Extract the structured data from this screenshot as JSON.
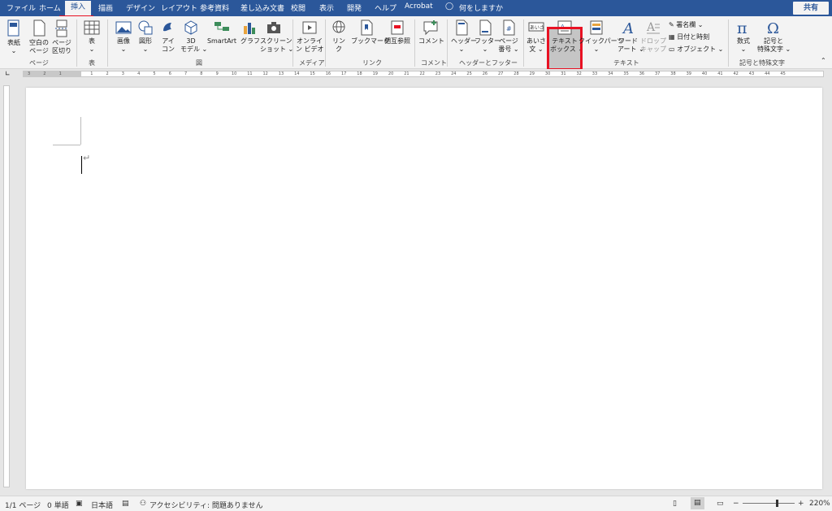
{
  "tabs": [
    {
      "label": "ファイル"
    },
    {
      "label": "ホーム"
    },
    {
      "label": "挿入"
    },
    {
      "label": "描画"
    },
    {
      "label": "デザイン"
    },
    {
      "label": "レイアウト"
    },
    {
      "label": "参考資料"
    },
    {
      "label": "差し込み文書"
    },
    {
      "label": "校閲"
    },
    {
      "label": "表示"
    },
    {
      "label": "開発"
    },
    {
      "label": "ヘルプ"
    },
    {
      "label": "Acrobat"
    }
  ],
  "active_tab": "挿入",
  "tell_me": "何をしますか",
  "share": "共有",
  "ribbon": {
    "pages": {
      "cover": "表紙",
      "blank1": "空白の",
      "blank2": "ページ",
      "break1": "ページ",
      "break2": "区切り",
      "group": "ページ"
    },
    "table": {
      "table": "表",
      "group": "表"
    },
    "illustrations": {
      "pictures": "画像",
      "shapes": "図形",
      "icons1": "アイ",
      "icons2": "コン",
      "model1": "3D",
      "model2": "モデル",
      "smartart": "SmartArt",
      "chart": "グラフ",
      "screenshot1": "スクリーン",
      "screenshot2": "ショット",
      "group": "図"
    },
    "media": {
      "video1": "オンライ",
      "video2": "ン ビデオ",
      "group": "メディア"
    },
    "links": {
      "link1": "リン",
      "link2": "ク",
      "bookmark": "ブックマーク",
      "crossref": "相互参照",
      "group": "リンク"
    },
    "comments": {
      "comment": "コメント",
      "group": "コメント"
    },
    "headerfooter": {
      "header": "ヘッダー",
      "footer": "フッター",
      "pagenum1": "ページ",
      "pagenum2": "番号",
      "group": "ヘッダーとフッター"
    },
    "text": {
      "greeting1": "あいさ",
      "greeting2": "文",
      "textbox1": "テキスト",
      "textbox2": "ボックス",
      "quickparts1": "クイック",
      "quickparts2": "パーツ",
      "wordart1": "ワード",
      "wordart2": "アート",
      "dropcap1": "ドロップ",
      "dropcap2": "キャップ",
      "signature": "署名欄",
      "datetime": "日付と時刻",
      "object": "オブジェクト",
      "group": "テキスト"
    },
    "symbols": {
      "equation": "数式",
      "symbol1": "記号と",
      "symbol2": "特殊文字",
      "group": "記号と特殊文字"
    }
  },
  "ruler_numbers": [
    "3",
    "2",
    "1",
    "",
    "1",
    "2",
    "3",
    "4",
    "5",
    "6",
    "7",
    "8",
    "9",
    "10",
    "11",
    "12",
    "13",
    "14",
    "15",
    "16",
    "17",
    "18",
    "19",
    "20",
    "21",
    "22",
    "23",
    "24",
    "25",
    "26",
    "27",
    "28",
    "29",
    "30",
    "31",
    "32",
    "33",
    "34",
    "35",
    "36",
    "37",
    "38",
    "39",
    "40",
    "41",
    "42",
    "43",
    "44",
    "45"
  ],
  "status": {
    "page": "1/1 ページ",
    "words": "0 単語",
    "language": "日本語",
    "accessibility": "アクセシビリティ: 問題ありません",
    "zoom": "220%"
  },
  "colors": {
    "accent": "#2b579a",
    "highlight": "#e81123"
  }
}
